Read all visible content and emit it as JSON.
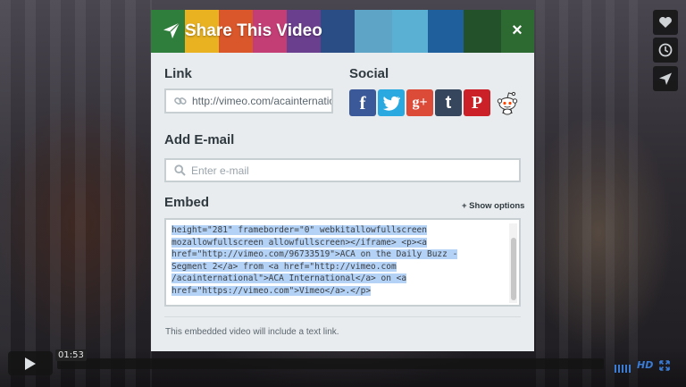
{
  "modal": {
    "title": "Share This Video",
    "close_label": "×",
    "header_stripe_colors": [
      "#2f7e3b",
      "#e8b221",
      "#d9572a",
      "#c43e76",
      "#6a3f8d",
      "#2b4d86",
      "#5ea4c7",
      "#59b0d2",
      "#1f5f9c",
      "#23512a",
      "#2c6a32"
    ]
  },
  "link": {
    "heading": "Link",
    "value": "http://vimeo.com/acainternational"
  },
  "social": {
    "heading": "Social",
    "icons": [
      {
        "name": "facebook",
        "glyph": "f",
        "color": "#3b5998"
      },
      {
        "name": "twitter",
        "glyph": "t",
        "color": "#2aa9e0"
      },
      {
        "name": "google-plus",
        "glyph": "g+",
        "color": "#dc4a38"
      },
      {
        "name": "tumblr",
        "glyph": "t",
        "color": "#36465d"
      },
      {
        "name": "pinterest",
        "glyph": "P",
        "color": "#cb2027"
      },
      {
        "name": "reddit",
        "glyph": "",
        "color": "#ff4500"
      }
    ]
  },
  "email": {
    "heading": "Add E-mail",
    "placeholder": "Enter e-mail",
    "value": ""
  },
  "embed": {
    "heading": "Embed",
    "show_options_label": "+ Show options",
    "code_lines": [
      "height=\"281\" frameborder=\"0\" webkitallowfullscreen",
      "mozallowfullscreen allowfullscreen></iframe> <p><a",
      "href=\"http://vimeo.com/96733519\">ACA on the Daily Buzz -",
      "Segment 2</a> from <a href=\"http://vimeo.com",
      "/acainternational\">ACA International</a> on <a",
      "href=\"https://vimeo.com\">Vimeo</a>.</p>"
    ],
    "footnote": "This embedded video will include a text link."
  },
  "player": {
    "current_time": "01:53",
    "hd_label": "HD",
    "side_controls": [
      "like-icon",
      "watch-later-icon",
      "share-icon"
    ],
    "accent_color": "#3a7bd5"
  }
}
